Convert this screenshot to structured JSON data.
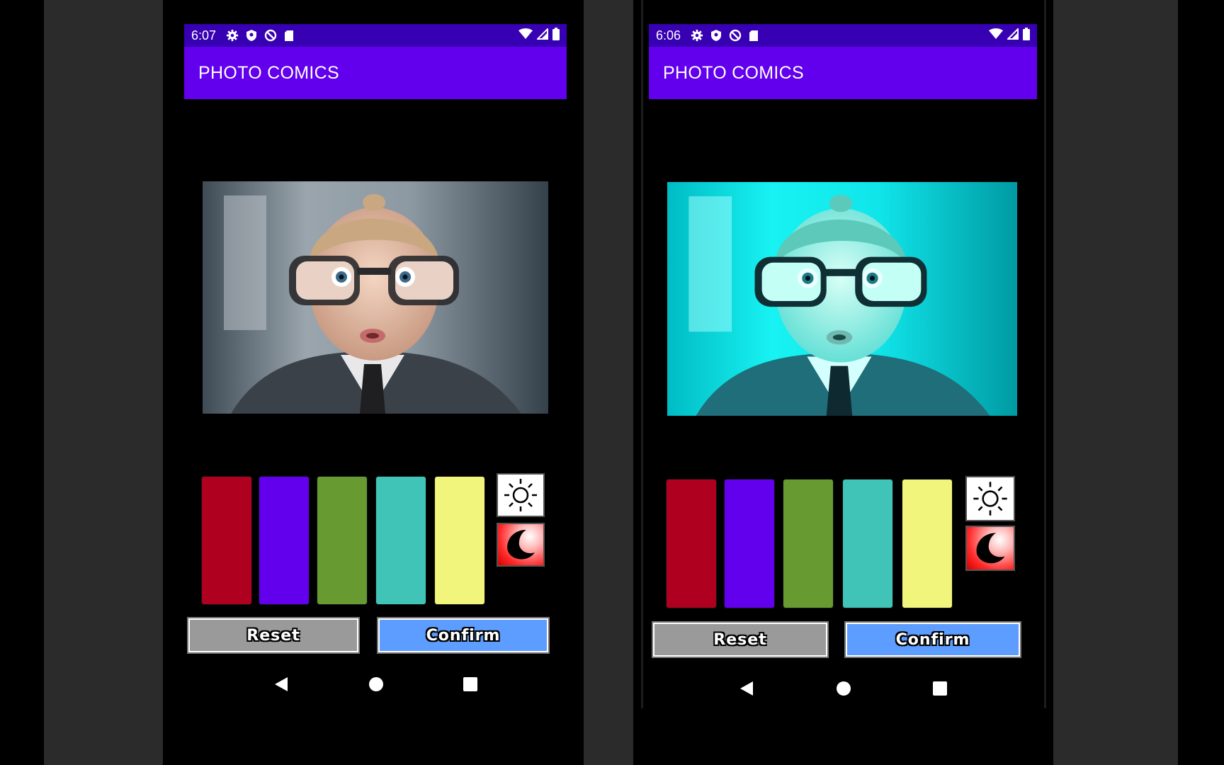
{
  "colors": {
    "app_bar": "#6200EE",
    "status_bar": "#3700B3",
    "swatches": [
      "#B00020",
      "#6200EE",
      "#689A32",
      "#40C4B8",
      "#F1F57B"
    ],
    "reset_button": "#9A9A9A",
    "confirm_button": "#5C9DFF"
  },
  "screens": [
    {
      "status_time": "6:07",
      "app_title": "PHOTO COMICS",
      "photo_filter": "original",
      "reset_label": "Reset",
      "confirm_label": "Confirm"
    },
    {
      "status_time": "6:06",
      "app_title": "PHOTO COMICS",
      "photo_filter": "cyan",
      "reset_label": "Reset",
      "confirm_label": "Confirm"
    }
  ],
  "icons": {
    "status_left": [
      "gear-icon",
      "shield-icon",
      "data-saver-icon",
      "sd-card-icon"
    ],
    "status_right": [
      "wifi-icon",
      "signal-icon",
      "battery-icon"
    ],
    "mode": [
      "sun-icon",
      "moon-icon"
    ],
    "nav": [
      "back-icon",
      "home-icon",
      "recents-icon"
    ]
  }
}
